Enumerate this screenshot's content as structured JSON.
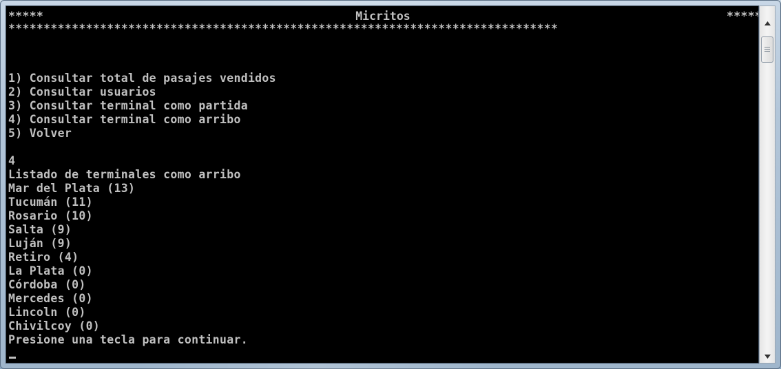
{
  "window": {
    "title": "Micritos",
    "header_left": "*****",
    "header_right": "*****",
    "header_rule": "******************************************************************************"
  },
  "menu": {
    "items": [
      "1) Consultar total de pasajes vendidos",
      "2) Consultar usuarios",
      "3) Consultar terminal como partida",
      "4) Consultar terminal como arribo",
      "5) Volver"
    ]
  },
  "console": {
    "input": "4",
    "list_title": "Listado de terminales como arribo",
    "terminals": [
      "Mar del Plata (13)",
      "Tucumán (11)",
      "Rosario (10)",
      "Salta (9)",
      "Luján (9)",
      "Retiro (4)",
      "La Plata (0)",
      "Córdoba (0)",
      "Mercedes (0)",
      "Lincoln (0)",
      "Chivilcoy (0)"
    ],
    "prompt": "Presione una tecla para continuar."
  },
  "scrollbar": {
    "up_icon": "arrow-up-icon",
    "down_icon": "arrow-down-icon",
    "thumb_grip_icon": "grip-icon"
  }
}
